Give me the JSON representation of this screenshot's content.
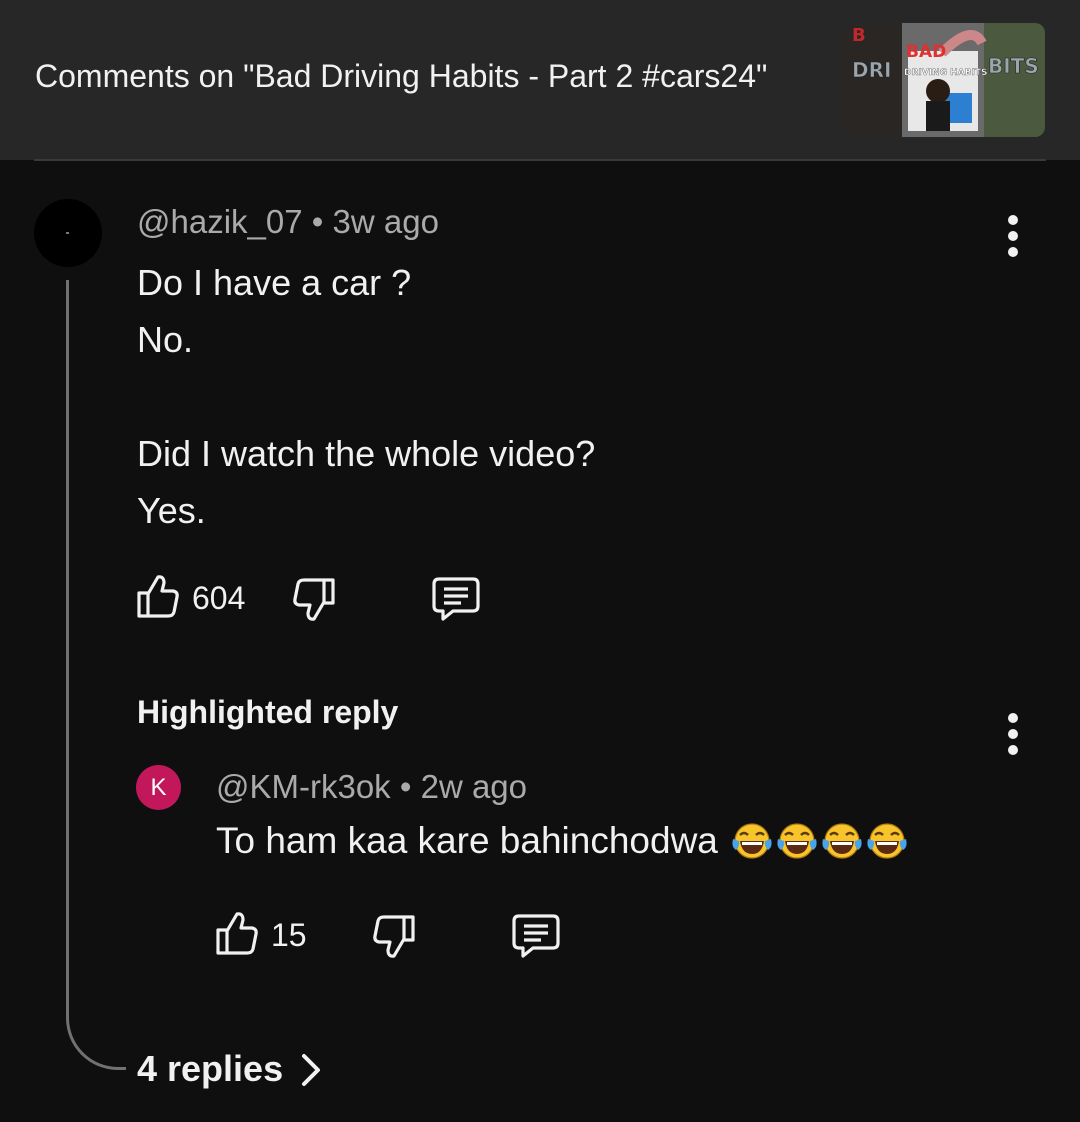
{
  "header": {
    "title": "Comments on \"Bad Driving Habits - Part 2 #cars24\"",
    "thumbnail": {
      "label_left": "DRI",
      "label_bad": "BAD",
      "label_driving": "DRIVING HABITS",
      "label_right": "BITS"
    }
  },
  "comment": {
    "author": "@hazik_07",
    "separator": "•",
    "time": "3w ago",
    "text": "Do I have a car ?\nNo.\n\nDid I watch the whole video?\nYes.",
    "likes": "604"
  },
  "highlighted_reply": {
    "label": "Highlighted reply",
    "avatar_letter": "K",
    "author": "@KM-rk3ok",
    "separator": "•",
    "time": "2w ago",
    "text": "To ham kaa kare bahinchodwa",
    "emoji": [
      "face-with-tears-of-joy",
      "face-with-tears-of-joy",
      "face-with-tears-of-joy",
      "face-with-tears-of-joy"
    ],
    "likes": "15"
  },
  "replies_link": "4 replies",
  "colors": {
    "background": "#0f0f0f",
    "header_bg": "#272727",
    "text": "#f1f1f1",
    "secondary_text": "#aaaaaa",
    "reply_avatar": "#c2185b"
  }
}
